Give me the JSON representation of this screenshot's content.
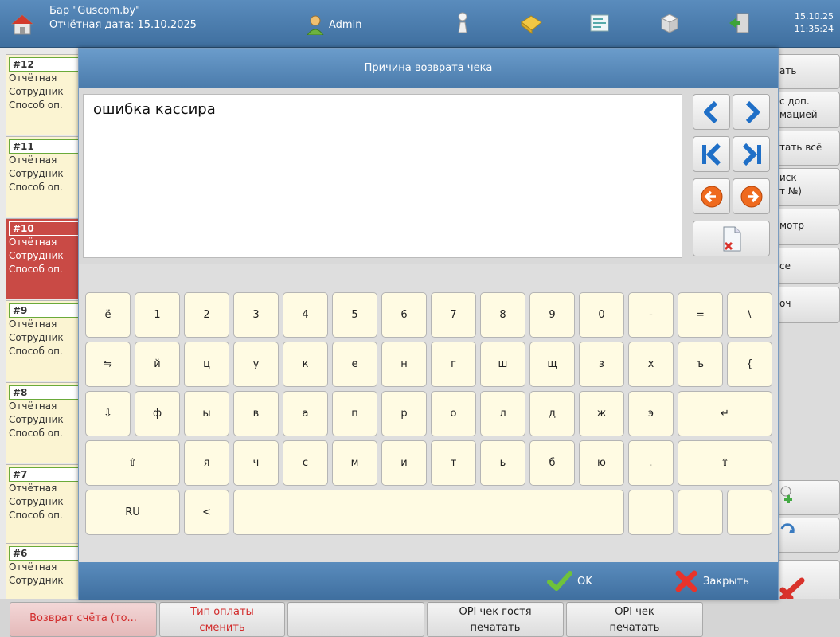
{
  "header": {
    "app_title": "Бар \"Guscom.by\"",
    "report_date": "Отчётная дата: 15.10.2025",
    "user": "Admin",
    "date": "15.10.25",
    "time": "11:35:24"
  },
  "left_list": [
    {
      "number": "#12",
      "lines": [
        "Отчётная",
        "Сотрудник",
        "Способ оп."
      ]
    },
    {
      "number": "#11",
      "lines": [
        "Отчётная",
        "Сотрудник",
        "Способ оп."
      ]
    },
    {
      "number": "#10",
      "lines": [
        "Отчётная",
        "Сотрудник",
        "Способ оп."
      ]
    },
    {
      "number": "#9",
      "lines": [
        "Отчётная",
        "Сотрудник",
        "Способ оп."
      ]
    },
    {
      "number": "#8",
      "lines": [
        "Отчётная",
        "Сотрудник",
        "Способ оп."
      ]
    },
    {
      "number": "#7",
      "lines": [
        "Отчётная",
        "Сотрудник",
        "Способ оп."
      ]
    },
    {
      "number": "#6",
      "lines": [
        "Отчётная",
        "Сотрудник"
      ]
    }
  ],
  "right_buttons": [
    {
      "line1": "ать",
      "line2": ""
    },
    {
      "line1": "с доп.",
      "line2": "мацией"
    },
    {
      "line1": "тать всё",
      "line2": ""
    },
    {
      "line1": "иск",
      "line2": "т №)"
    },
    {
      "line1": "мотр",
      "line2": ""
    },
    {
      "line1": "се",
      "line2": ""
    },
    {
      "line1": "оч",
      "line2": ""
    }
  ],
  "modal": {
    "title": "Причина возврата чека",
    "text": "ошибка кассира",
    "ok_label": "OK",
    "close_label": "Закрыть"
  },
  "keyboard": {
    "row1": [
      "ё",
      "1",
      "2",
      "3",
      "4",
      "5",
      "6",
      "7",
      "8",
      "9",
      "0",
      "-",
      "=",
      "\\"
    ],
    "row2": [
      "⇋",
      "й",
      "ц",
      "у",
      "к",
      "е",
      "н",
      "г",
      "ш",
      "щ",
      "з",
      "х",
      "ъ",
      "{"
    ],
    "row3": [
      "⇩",
      "ф",
      "ы",
      "в",
      "а",
      "п",
      "р",
      "о",
      "л",
      "д",
      "ж",
      "э",
      "↵"
    ],
    "row4": [
      "⇧",
      "я",
      "ч",
      "с",
      "м",
      "и",
      "т",
      "ь",
      "б",
      "ю",
      ".",
      "⇧"
    ],
    "row5": [
      "RU",
      "<",
      "",
      "",
      ""
    ]
  },
  "bottom": {
    "return_label": "Возврат счёта (то...",
    "pay_type_line1": "Тип оплаты",
    "pay_type_line2": "сменить",
    "opi_guest_line1": "OPI чек гостя",
    "opi_guest_line2": "печатать",
    "opi_line1": "OPI чек",
    "opi_line2": "печатать"
  },
  "colors": {
    "header_blue": "#4a7bab",
    "key_bg": "#fffbe3",
    "selected_red": "#c94a45",
    "alert_red": "#d9322b"
  }
}
